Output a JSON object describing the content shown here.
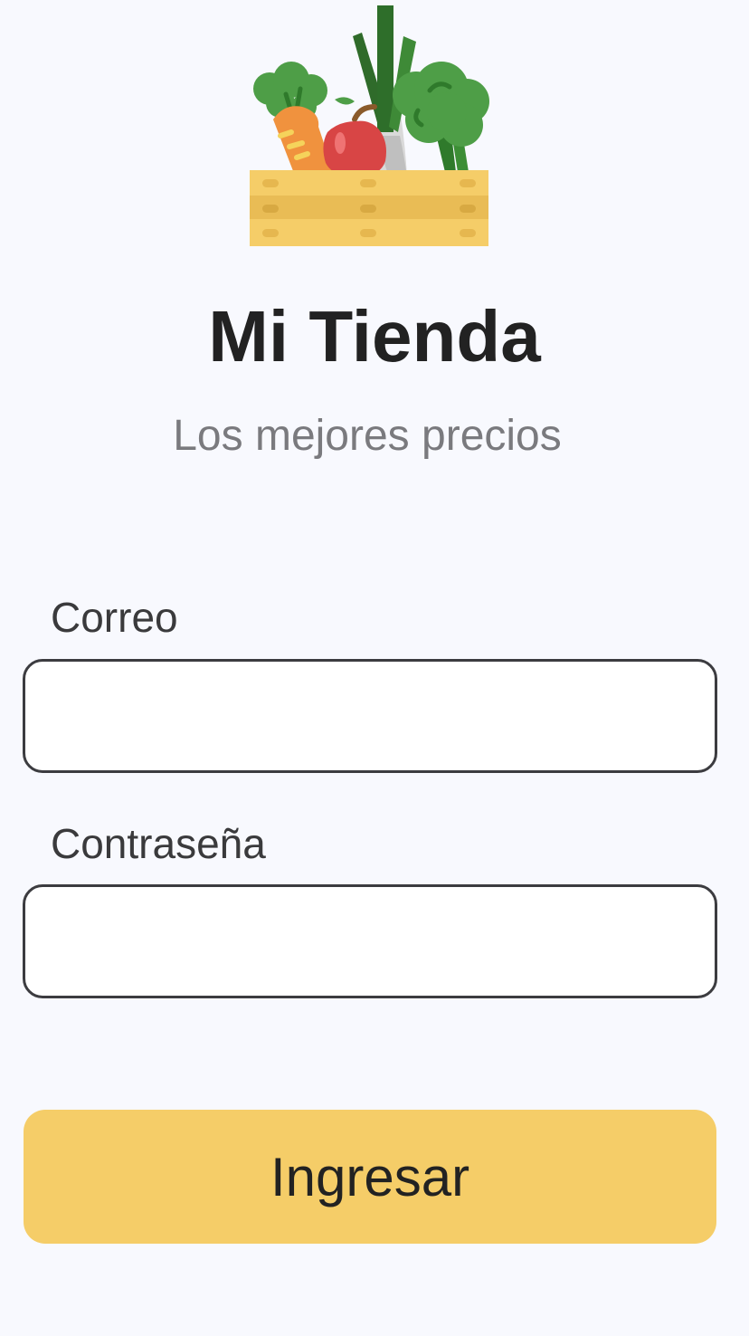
{
  "brand": {
    "logo_icon": "vegetable-crate-icon",
    "title": "Mi Tienda",
    "subtitle": "Los mejores precios"
  },
  "form": {
    "email": {
      "label": "Correo",
      "value": "",
      "placeholder": ""
    },
    "password": {
      "label": "Contraseña",
      "value": "",
      "placeholder": ""
    },
    "submit_label": "Ingresar"
  },
  "colors": {
    "background": "#F8F9FE",
    "accent": "#F5CD68",
    "title": "#222222",
    "subtitle": "#7A7A7E",
    "input_border": "#3C3C40"
  }
}
